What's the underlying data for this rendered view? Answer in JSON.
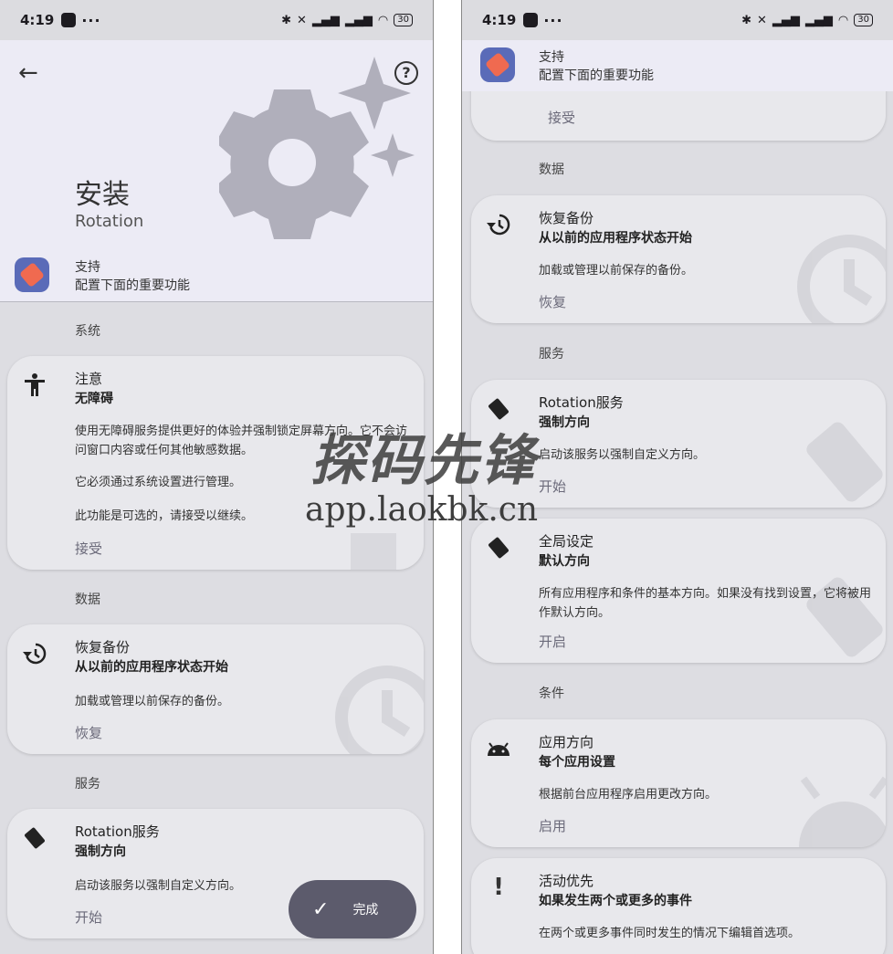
{
  "status": {
    "time": "4:19",
    "dots": "···",
    "battery": "30"
  },
  "header": {
    "title": "安装",
    "subtitle": "Rotation"
  },
  "support": {
    "title": "支持",
    "subtitle": "配置下面的重要功能"
  },
  "sections": {
    "system": "系统",
    "data": "数据",
    "service": "服务",
    "condition": "条件"
  },
  "cards": {
    "accessibility": {
      "title": "注意",
      "subtitle": "无障碍",
      "desc1": "使用无障碍服务提供更好的体验并强制锁定屏幕方向。它不会访问窗口内容或任何其他敏感数据。",
      "desc2": "它必须通过系统设置进行管理。",
      "desc3": "此功能是可选的，请接受以继续。",
      "action": "接受"
    },
    "restore": {
      "title": "恢复备份",
      "subtitle": "从以前的应用程序状态开始",
      "desc": "加载或管理以前保存的备份。",
      "action": "恢复"
    },
    "service": {
      "title": "Rotation服务",
      "subtitle": "强制方向",
      "desc": "启动该服务以强制自定义方向。",
      "action": "开始"
    },
    "global": {
      "title": "全局设定",
      "subtitle": "默认方向",
      "desc": "所有应用程序和条件的基本方向。如果没有找到设置，它将被用作默认方向。",
      "action": "开启"
    },
    "app_orientation": {
      "title": "应用方向",
      "subtitle": "每个应用设置",
      "desc": "根据前台应用程序启用更改方向。",
      "action": "启用"
    },
    "event": {
      "title": "活动优先",
      "subtitle": "如果发生两个或更多的事件",
      "desc": "在两个或更多事件同时发生的情况下编辑首选项。"
    },
    "prev_action": "接受"
  },
  "fab": {
    "label": "完成"
  },
  "watermark": {
    "big": "探码先锋",
    "small": "app.laokbk.cn"
  },
  "icons": {
    "back": "arrow-left-icon",
    "help": "help-circle-icon",
    "accessibility": "accessibility-icon",
    "history": "history-icon",
    "rotation": "rotation-icon",
    "android": "android-icon",
    "priority": "exclamation-icon",
    "check": "check-icon"
  }
}
